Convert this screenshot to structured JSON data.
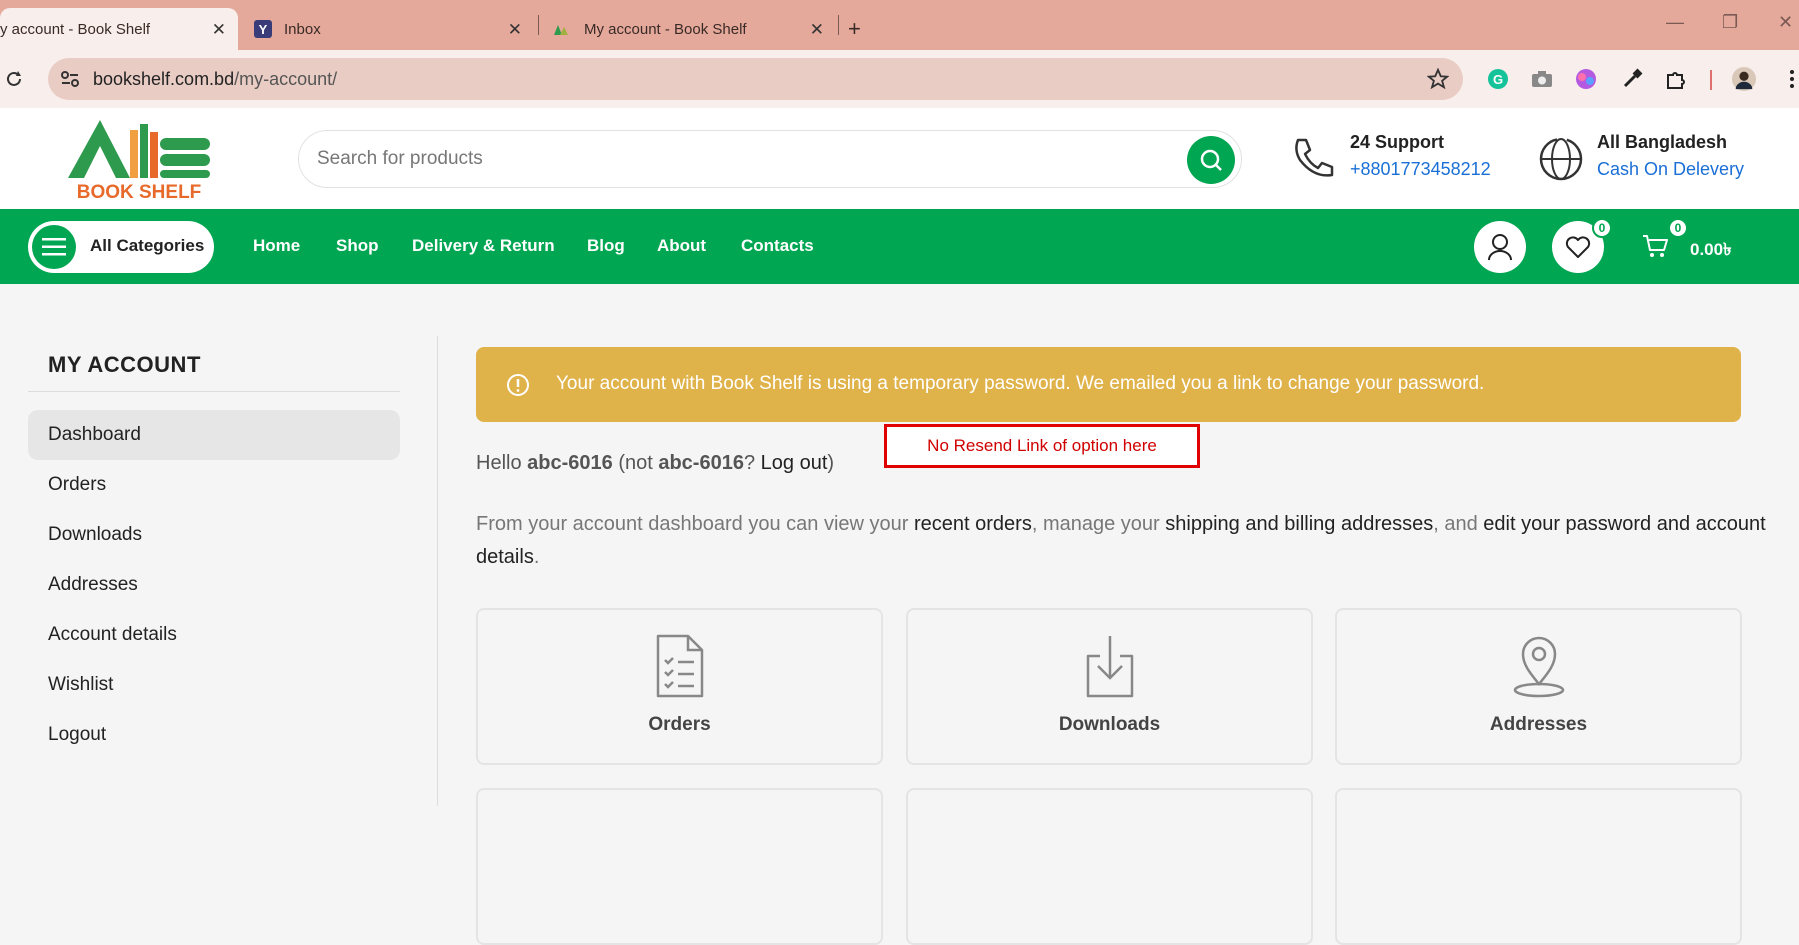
{
  "browser": {
    "tabs": [
      {
        "title": "y account - Book Shelf",
        "active": true
      },
      {
        "title": "Inbox",
        "active": false
      },
      {
        "title": "My account - Book Shelf",
        "active": false
      }
    ],
    "new_tab": "+",
    "url_domain": "bookshelf.com.bd",
    "url_path": "/my-account/"
  },
  "header": {
    "logo_text": "BOOK SHELF",
    "search_placeholder": "Search for products",
    "support_title": "24 Support",
    "support_phone": "+8801773458212",
    "region_title": "All Bangladesh",
    "region_sub": "Cash On Delevery"
  },
  "nav": {
    "all_categories": "All Categories",
    "links": [
      "Home",
      "Shop",
      "Delivery & Return",
      "Blog",
      "About",
      "Contacts"
    ],
    "wishlist_count": "0",
    "cart_count": "0",
    "cart_total": "0.00৳"
  },
  "sidebar": {
    "title": "MY ACCOUNT",
    "items": [
      "Dashboard",
      "Orders",
      "Downloads",
      "Addresses",
      "Account details",
      "Wishlist",
      "Logout"
    ],
    "active": "Dashboard"
  },
  "main": {
    "notice": "Your account with Book Shelf is using a temporary password. We emailed you a link to change your password.",
    "annotation": "No Resend Link of option here",
    "hello_prefix": "Hello ",
    "username": "abc-6016",
    "hello_not": " (not ",
    "username2": "abc-6016",
    "hello_q": "? ",
    "logout_link": "Log out",
    "hello_close": ")",
    "intro_1": "From your account dashboard you can view your ",
    "intro_link_orders": "recent orders",
    "intro_2": ", manage your ",
    "intro_link_addresses": "shipping and billing addresses",
    "intro_3": ", and ",
    "intro_link_account": "edit your password and account details",
    "intro_4": ".",
    "cards": [
      "Orders",
      "Downloads",
      "Addresses"
    ]
  },
  "colors": {
    "brand_green": "#00a651",
    "notice_bg": "#e0b24a",
    "tab_strip": "#e4a99b",
    "annotation_red": "#e00000"
  }
}
